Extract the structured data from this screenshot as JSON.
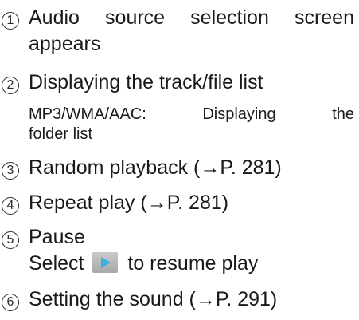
{
  "items": [
    {
      "number": "1",
      "line1": "Audio source selection screen",
      "line2": "appears"
    },
    {
      "number": "2",
      "text": "Displaying the track/file list",
      "note_line1": "MP3/WMA/AAC: Displaying the",
      "note_line2": "folder list"
    },
    {
      "number": "3",
      "text": "Random playback (→P. 281)"
    },
    {
      "number": "4",
      "text": "Repeat play (→P. 281)"
    },
    {
      "number": "5",
      "text": "Pause",
      "line2_before": "Select",
      "line2_icon": "play-icon",
      "line2_after": "to resume play"
    },
    {
      "number": "6",
      "text": "Setting the sound (→P. 291)"
    }
  ],
  "colors": {
    "text": "#1a1a1a",
    "play_icon_bg": "#b9b9b9",
    "play_icon_arrow": "#3ab0e0"
  }
}
